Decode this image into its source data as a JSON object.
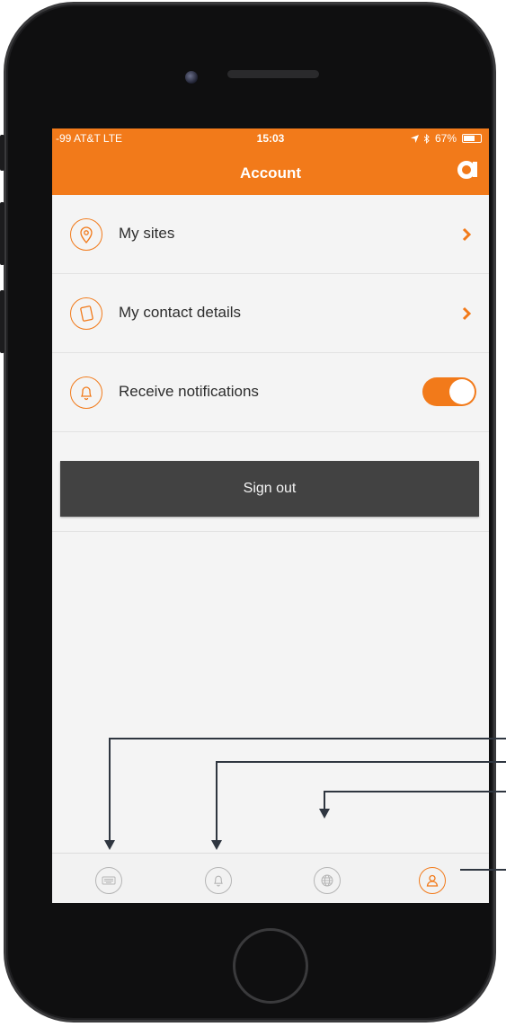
{
  "status_bar": {
    "carrier": "-99 AT&T  LTE",
    "time": "15:03",
    "battery_percent": "67%",
    "battery_level": 0.67
  },
  "header": {
    "title": "Account",
    "logo_icon": "brand-a-logo-icon"
  },
  "menu": {
    "my_sites": {
      "label": "My sites",
      "icon": "location-pin-icon"
    },
    "contact_details": {
      "label": "My contact details",
      "icon": "phone-device-icon"
    },
    "notifications": {
      "label": "Receive notifications",
      "icon": "bell-icon",
      "enabled": true
    }
  },
  "sign_out_label": "Sign out",
  "tabbar": {
    "items": [
      {
        "name": "keyboard-icon",
        "active": false
      },
      {
        "name": "bell-icon",
        "active": false
      },
      {
        "name": "globe-icon",
        "active": false
      },
      {
        "name": "user-icon",
        "active": true
      }
    ]
  },
  "colors": {
    "accent": "#f27a1a",
    "background": "#f4f4f4",
    "button_dark": "#424242",
    "text": "#2d2d2d",
    "inactive_icon": "#b5b5b5"
  }
}
